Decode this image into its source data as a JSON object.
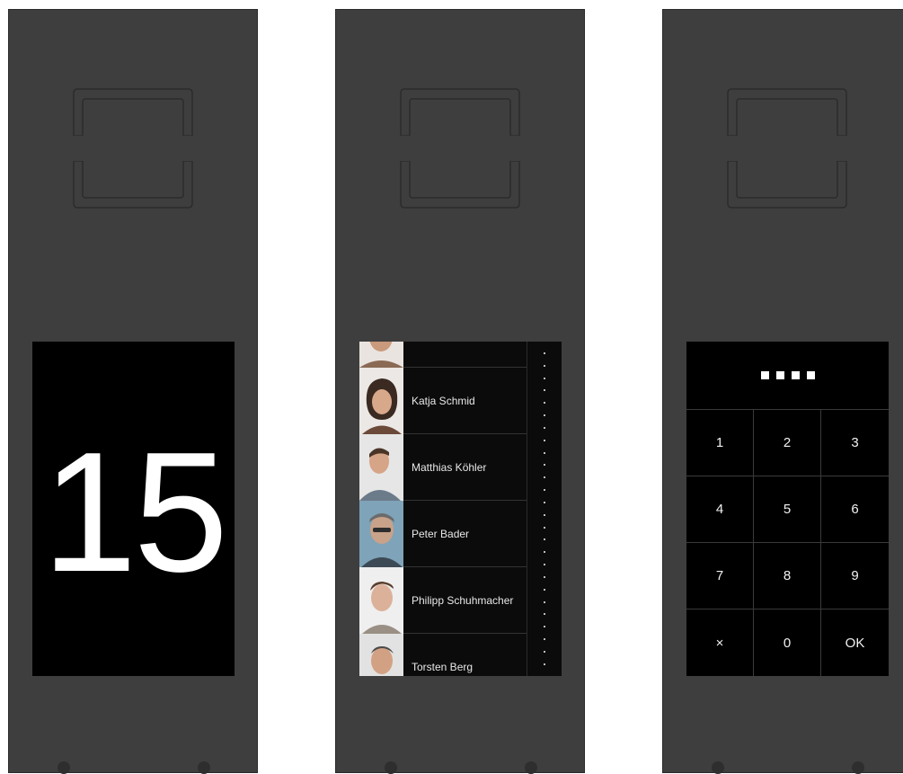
{
  "panels": {
    "number": {
      "value": "15"
    },
    "directory": {
      "entries": [
        {
          "name": ""
        },
        {
          "name": "Katja Schmid"
        },
        {
          "name": "Matthias Köhler"
        },
        {
          "name": "Peter Bader"
        },
        {
          "name": "Philipp Schuhmacher"
        },
        {
          "name": "Torsten Berg"
        }
      ]
    },
    "keypad": {
      "keys": [
        "1",
        "2",
        "3",
        "4",
        "5",
        "6",
        "7",
        "8",
        "9",
        "×",
        "0",
        "OK"
      ]
    }
  },
  "colors": {
    "panel": "#3e3e3e",
    "screen": "#000000",
    "text": "#ffffff"
  }
}
